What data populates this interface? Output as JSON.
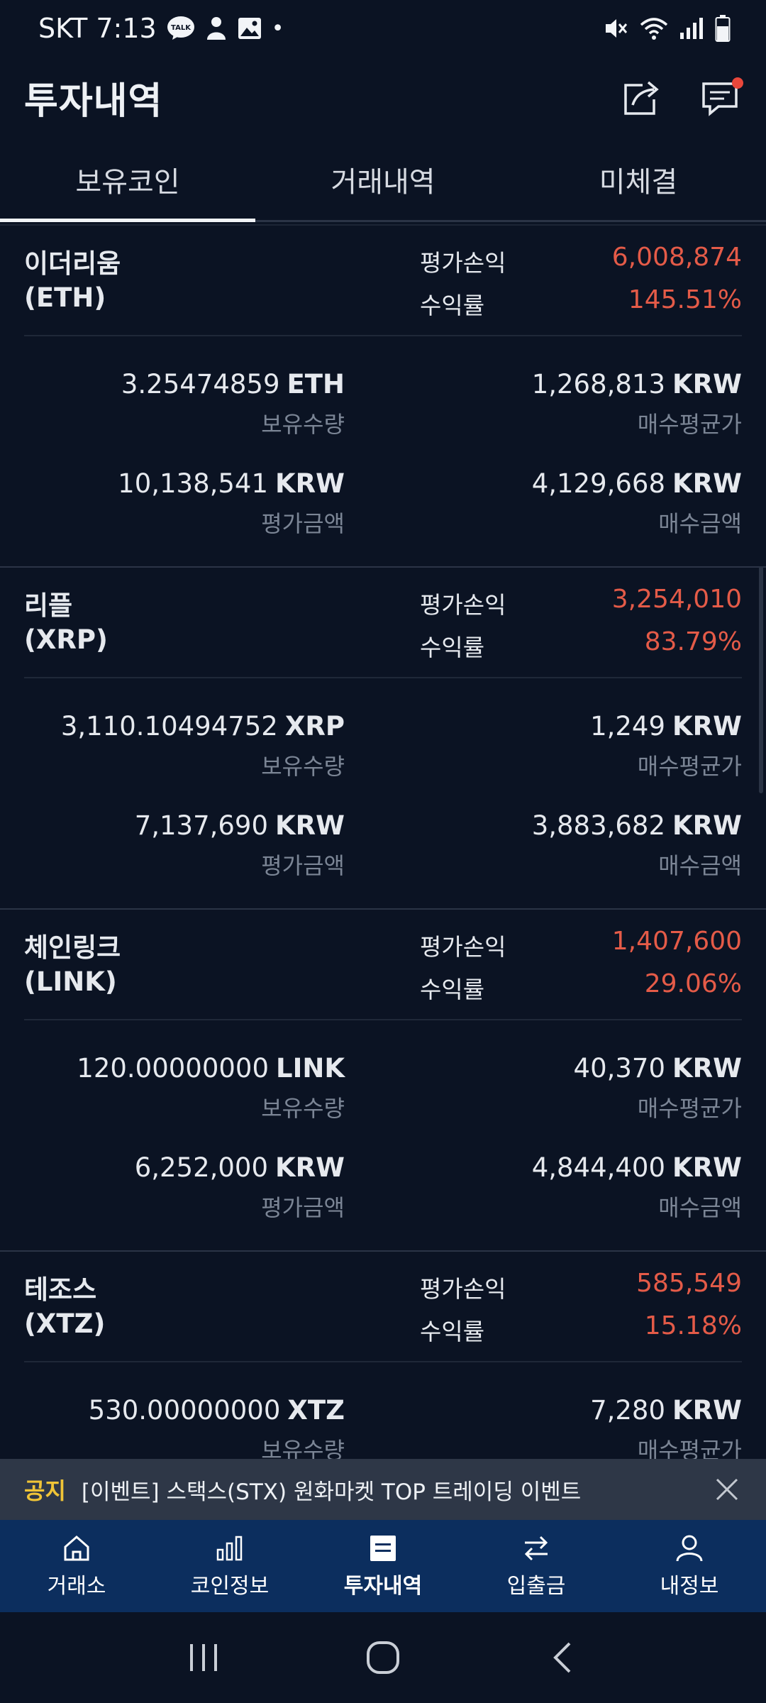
{
  "status_bar": {
    "carrier_time": "SKT 7:13",
    "talk_badge": "TALK",
    "dot": "•",
    "icons": [
      "talk-icon",
      "person-icon",
      "gallery-icon",
      "mute-icon",
      "wifi-icon",
      "signal-icon",
      "battery-icon"
    ]
  },
  "header": {
    "title": "투자내역",
    "share_icon": "share-icon",
    "chat_icon": "chat-icon"
  },
  "tabs": [
    {
      "label": "보유코인",
      "active": true
    },
    {
      "label": "거래내역",
      "active": false
    },
    {
      "label": "미체결",
      "active": false
    }
  ],
  "labels": {
    "profit_loss": "평가손익",
    "return_rate": "수익률",
    "holding_qty": "보유수량",
    "avg_buy_price": "매수평균가",
    "eval_amount": "평가금액",
    "buy_amount": "매수금액",
    "currency": "KRW"
  },
  "holdings": [
    {
      "name": "이더리움",
      "symbol": "(ETH)",
      "unit": "ETH",
      "profit_loss": "6,008,874",
      "return_rate": "145.51%",
      "quantity": "3.25474859",
      "avg_price": "1,268,813",
      "eval_amount": "10,138,541",
      "buy_amount": "4,129,668"
    },
    {
      "name": "리플",
      "symbol": "(XRP)",
      "unit": "XRP",
      "profit_loss": "3,254,010",
      "return_rate": "83.79%",
      "quantity": "3,110.10494752",
      "avg_price": "1,249",
      "eval_amount": "7,137,690",
      "buy_amount": "3,883,682"
    },
    {
      "name": "체인링크",
      "symbol": "(LINK)",
      "unit": "LINK",
      "profit_loss": "1,407,600",
      "return_rate": "29.06%",
      "quantity": "120.00000000",
      "avg_price": "40,370",
      "eval_amount": "6,252,000",
      "buy_amount": "4,844,400"
    },
    {
      "name": "테조스",
      "symbol": "(XTZ)",
      "unit": "XTZ",
      "profit_loss": "585,549",
      "return_rate": "15.18%",
      "quantity": "530.00000000",
      "avg_price": "7,280",
      "eval_amount": "",
      "buy_amount": ""
    }
  ],
  "notice": {
    "tag": "공지",
    "text": "[이벤트] 스택스(STX) 원화마켓 TOP 트레이딩 이벤트",
    "close_icon": "close-icon"
  },
  "bottom_nav": [
    {
      "label": "거래소",
      "icon": "home-icon",
      "active": false
    },
    {
      "label": "코인정보",
      "icon": "bar-chart-icon",
      "active": false
    },
    {
      "label": "투자내역",
      "icon": "list-icon",
      "active": true
    },
    {
      "label": "입출금",
      "icon": "transfer-icon",
      "active": false
    },
    {
      "label": "내정보",
      "icon": "user-icon",
      "active": false
    }
  ],
  "colors": {
    "background": "#0b1323",
    "profit": "#e45b48",
    "nav_bg": "#0c2e5e",
    "notice_tag": "#f0c437",
    "notice_bg": "#2e3747"
  }
}
